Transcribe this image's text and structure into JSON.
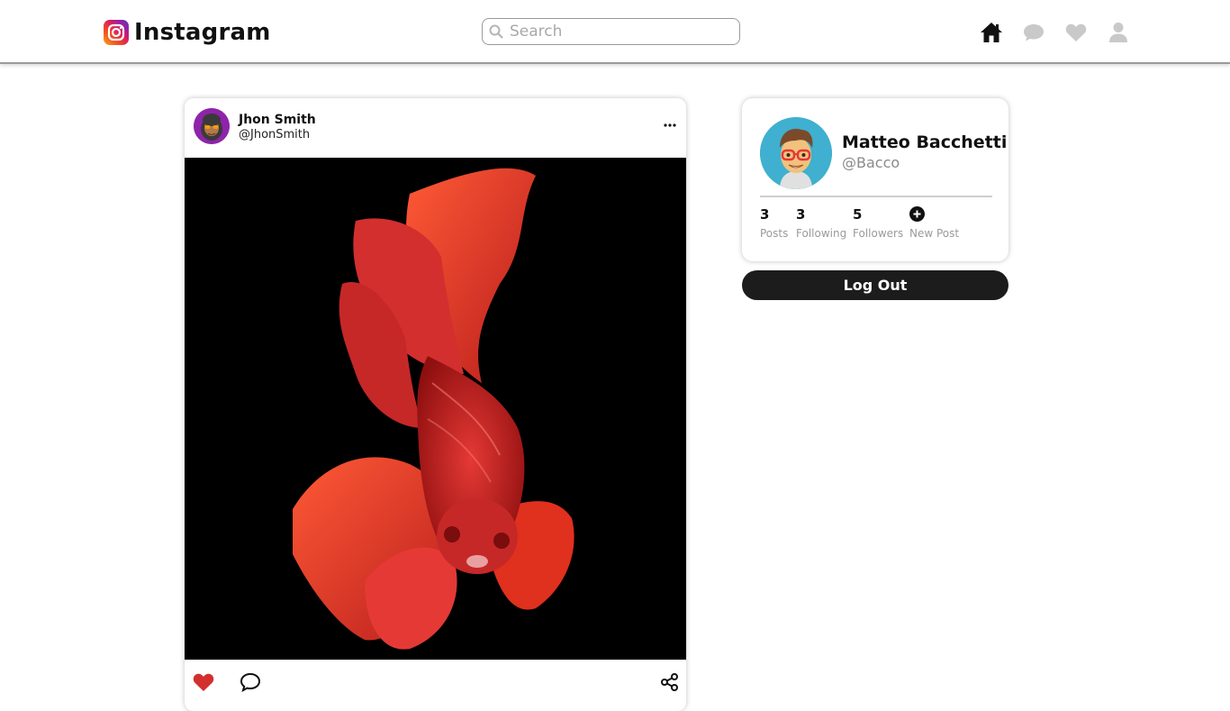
{
  "header": {
    "brand_name": "Instagram",
    "brand_icon": "instagram-logo-icon",
    "search": {
      "placeholder": "Search",
      "value": ""
    },
    "nav": [
      {
        "name": "home-icon",
        "active": true
      },
      {
        "name": "messages-icon",
        "active": false
      },
      {
        "name": "heart-icon",
        "active": false
      },
      {
        "name": "profile-icon",
        "active": false
      }
    ]
  },
  "post": {
    "author_name": "Jhon Smith",
    "author_handle": "@JhonSmith",
    "image": "red-betta-fish-photo",
    "liked": true,
    "actions": [
      "heart-icon",
      "comment-icon",
      "share-icon"
    ]
  },
  "profile": {
    "name": "Matteo Bacchetti",
    "handle": "@Bacco",
    "stats": {
      "posts": {
        "value": "3",
        "label": "Posts"
      },
      "following": {
        "value": "3",
        "label": "Following"
      },
      "followers": {
        "value": "5",
        "label": "Followers"
      },
      "new_post": {
        "label": "New Post"
      }
    },
    "logout_label": "Log Out"
  },
  "colors": {
    "like_red": "#d32f2f",
    "nav_inactive": "#c9c9c9",
    "avatar_bg_profile": "#3fb0cf",
    "avatar_bg_post": "#8e24aa",
    "button_dark": "#1c1c1c"
  }
}
